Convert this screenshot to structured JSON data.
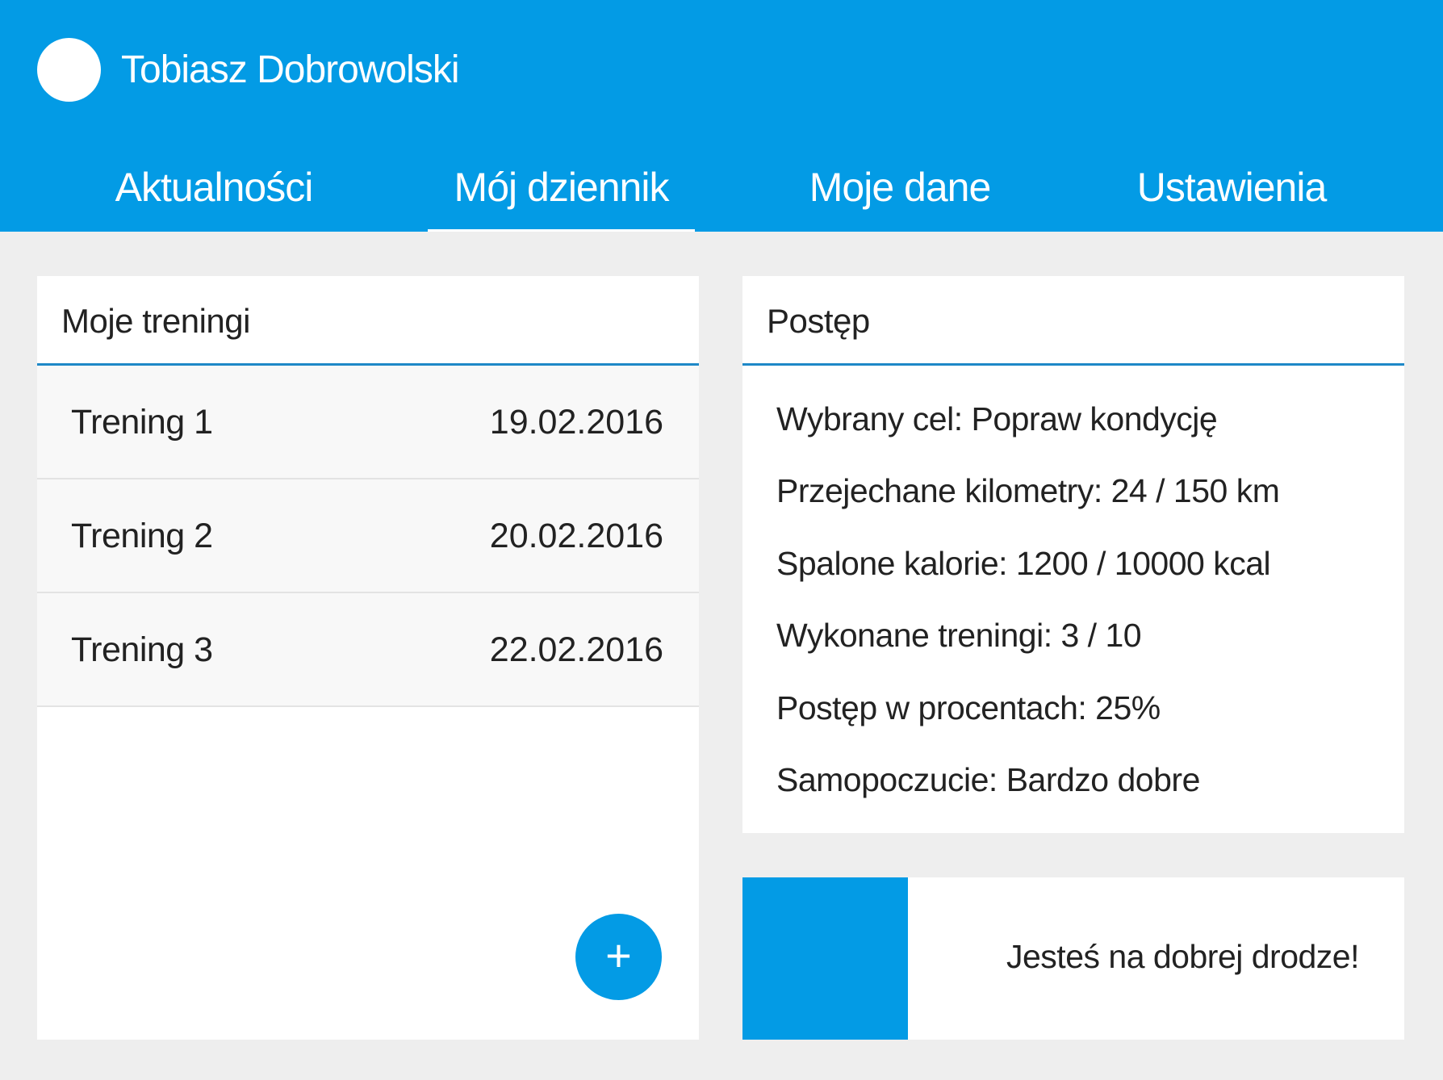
{
  "user": {
    "name": "Tobiasz Dobrowolski"
  },
  "nav": {
    "tabs": [
      {
        "label": "Aktualności"
      },
      {
        "label": "Mój dziennik",
        "active": true
      },
      {
        "label": "Moje dane"
      },
      {
        "label": "Ustawienia"
      }
    ]
  },
  "trainings": {
    "title": "Moje treningi",
    "items": [
      {
        "name": "Trening 1",
        "date": "19.02.2016"
      },
      {
        "name": "Trening 2",
        "date": "20.02.2016"
      },
      {
        "name": "Trening 3",
        "date": "22.02.2016"
      }
    ],
    "add_icon": "+"
  },
  "progress": {
    "title": "Postęp",
    "stats": [
      "Wybrany cel: Popraw kondycję",
      "Przejechane kilometry: 24 / 150 km",
      "Spalone kalorie: 1200 / 10000 kcal",
      "Wykonane treningi: 3 / 10",
      "Postęp w procentach: 25%",
      "Samopoczucie: Bardzo dobre"
    ]
  },
  "status": {
    "message": "Jesteś na dobrej drodze!"
  },
  "colors": {
    "accent": "#039be5",
    "background": "#eeeeee",
    "divider": "#1e88c7"
  }
}
